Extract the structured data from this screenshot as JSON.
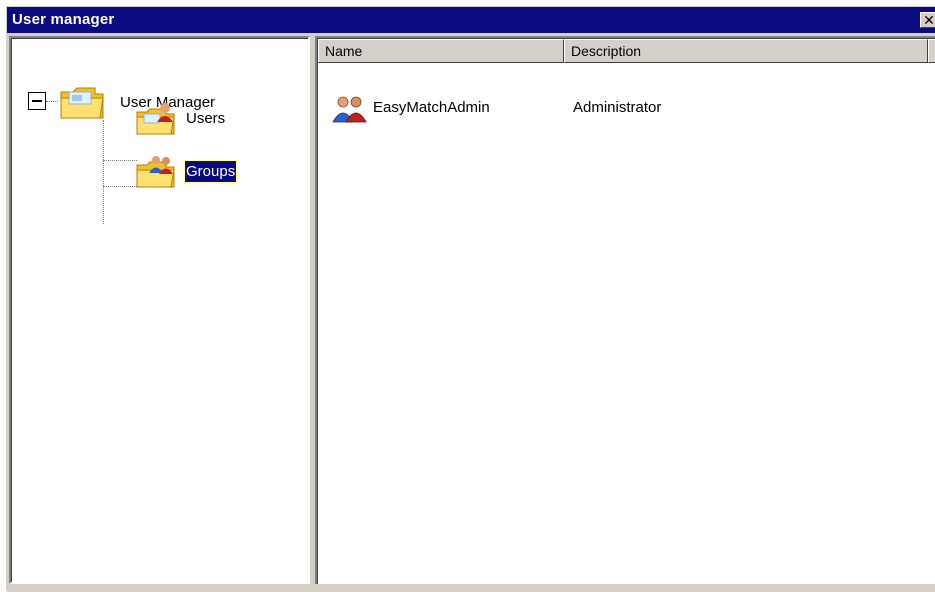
{
  "window": {
    "title": "User manager",
    "close_glyph": "✕"
  },
  "tree": {
    "root": {
      "label": "User Manager",
      "icon": "folder-icon",
      "expanded": true
    },
    "children": [
      {
        "label": "Users",
        "icon": "folder-user-icon",
        "selected": false
      },
      {
        "label": "Groups",
        "icon": "folder-group-icon",
        "selected": true
      }
    ]
  },
  "list": {
    "columns": [
      "Name",
      "Description"
    ],
    "rows": [
      {
        "icon": "group-icon",
        "name": "EasyMatchAdmin",
        "description": "Administrator"
      }
    ]
  },
  "colors": {
    "titlebar": "#0a0a80",
    "selection": "#0a0a80",
    "face": "#d4d0c8"
  }
}
